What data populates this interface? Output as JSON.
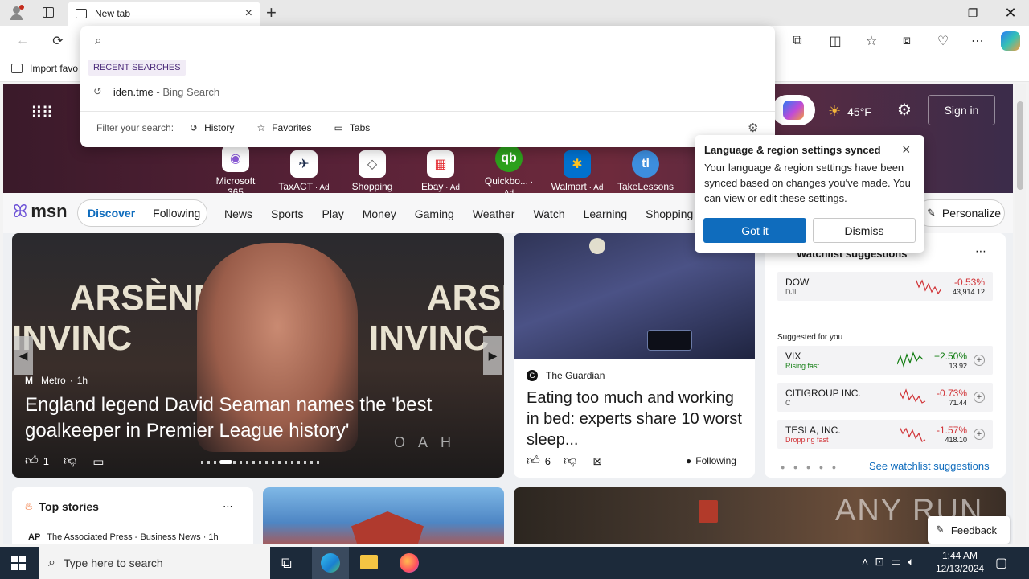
{
  "browser": {
    "tab_title": "New tab",
    "new_tab_symbol": "+",
    "favorites_bar": {
      "import_label": "Import favo"
    }
  },
  "omnibox": {
    "placeholder": "",
    "recent_label": "RECENT SEARCHES",
    "recent_items": [
      {
        "query": "iden.tme",
        "source": " - Bing Search"
      }
    ],
    "filter_label": "Filter your search:",
    "filters": [
      "History",
      "Favorites",
      "Tabs"
    ]
  },
  "hero": {
    "weather_temp": "45°F",
    "sign_in": "Sign in",
    "apps": [
      {
        "label": "Microsoft 365",
        "ad": ""
      },
      {
        "label": "TaxACT",
        "ad": " · Ad"
      },
      {
        "label": "Shopping",
        "ad": ""
      },
      {
        "label": "Ebay",
        "ad": " · Ad"
      },
      {
        "label": "Quickbo...",
        "ad": " · Ad"
      },
      {
        "label": "Walmart",
        "ad": " · Ad"
      },
      {
        "label": "TakeLessons",
        "ad": ""
      }
    ]
  },
  "msn": {
    "logo": "msn",
    "discover": "Discover",
    "following": "Following",
    "nav": [
      "News",
      "Sports",
      "Play",
      "Money",
      "Gaming",
      "Weather",
      "Watch",
      "Learning",
      "Shopping"
    ],
    "personalize": "Personalize"
  },
  "main_story": {
    "source": "Metro",
    "time": "1h",
    "headline": "England legend David Seaman names the 'best goalkeeper in Premier League history'",
    "likes": "1",
    "banner_text_left": "ARSÈNE WE\nINVINC",
    "banner_text_right": "ARSÈNE W\nINVINC",
    "overlay": "O A H"
  },
  "side_story": {
    "source": "The Guardian",
    "headline": "Eating too much and working in bed: experts share 10 worst sleep...",
    "likes": "6",
    "following": "Following"
  },
  "watchlist": {
    "title": "Watchlist suggestions",
    "suggested_label": "Suggested for you",
    "items": [
      {
        "name": "DOW",
        "sub": "DJI",
        "change": "-0.53%",
        "price": "43,914.12",
        "tag": "",
        "color": "#d13438"
      },
      {
        "name": "VIX",
        "sub": "Rising fast",
        "change": "+2.50%",
        "price": "13.92",
        "tag": "rising",
        "color": "#107c10"
      },
      {
        "name": "CITIGROUP INC.",
        "sub": "C",
        "change": "-0.73%",
        "price": "71.44",
        "tag": "",
        "color": "#d13438"
      },
      {
        "name": "TESLA, INC.",
        "sub": "Dropping fast",
        "change": "-1.57%",
        "price": "418.10",
        "tag": "dropping",
        "color": "#d13438"
      }
    ],
    "see_more": "See watchlist suggestions"
  },
  "top_stories": {
    "title": "Top stories",
    "first_source": "The Associated Press - Business News · 1h"
  },
  "feedback": "Feedback",
  "popup": {
    "title": "Language & region settings synced",
    "body": "Your language & region settings have been synced based on changes you've made. You can view or edit these settings.",
    "primary": "Got it",
    "secondary": "Dismiss"
  },
  "watermark": "ANY RUN",
  "taskbar": {
    "search_placeholder": "Type here to search",
    "time": "1:44 AM",
    "date": "12/13/2024"
  },
  "colors": {
    "accent": "#0f6cbd",
    "taskbar": "#1c2a3a",
    "negative": "#d13438",
    "positive": "#107c10"
  }
}
